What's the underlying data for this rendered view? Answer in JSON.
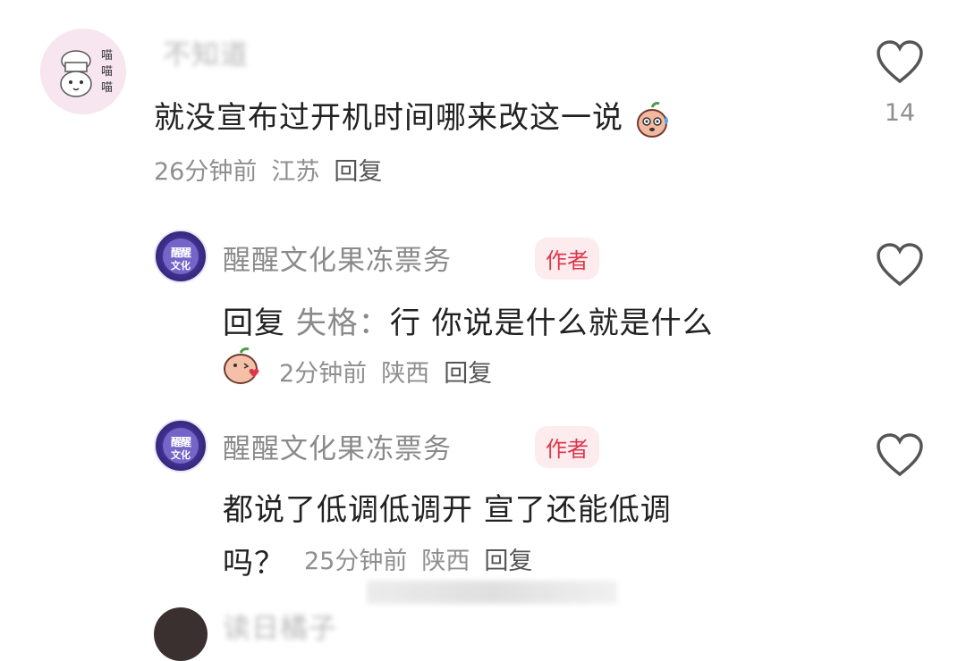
{
  "comments": [
    {
      "username": "不知道",
      "text": "就没宣布过开机时间哪来改这一说",
      "time": "26分钟前",
      "location": "江苏",
      "reply_label": "回复",
      "likes": "14",
      "avatar_text": "喵喵喵"
    },
    {
      "username": "醒醒文化果冻票务",
      "badge": "作者",
      "reply_prefix": "回复",
      "mention": "失格：",
      "text": "行 你说是什么就是什么",
      "time": "2分钟前",
      "location": "陕西",
      "reply_label": "回复",
      "avatar_text_1": "醒醒",
      "avatar_text_2": "文化"
    },
    {
      "username": "醒醒文化果冻票务",
      "badge": "作者",
      "text_line1": "都说了低调低调开 宣了还能低调",
      "text_line2": "吗？",
      "time": "25分钟前",
      "location": "陕西",
      "reply_label": "回复",
      "avatar_text_1": "醒醒",
      "avatar_text_2": "文化"
    },
    {
      "username": "读日橘子"
    }
  ],
  "colors": {
    "author_badge_bg": "#fdecee",
    "author_badge_text": "#e0354b",
    "meta": "#8f8f8f"
  }
}
